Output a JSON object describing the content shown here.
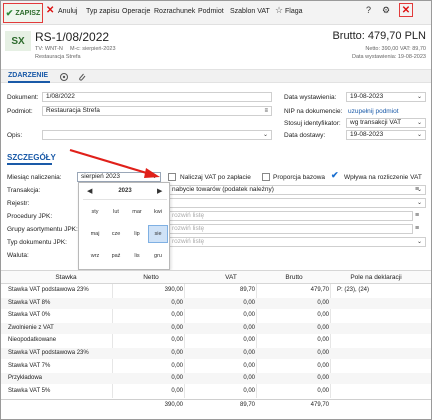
{
  "toolbar": {
    "save_label": "ZAPISZ",
    "cancel_label": "Anuluj",
    "typ_zapisu_label": "Typ zapisu",
    "operacje_label": "Operacje",
    "rozrachunek_label": "Rozrachunek",
    "podmiot_label": "Podmiot",
    "szablon_vat_label": "Szablon VAT",
    "flaga_label": "Flaga",
    "help_glyph": "?",
    "settings_glyph": "⚙",
    "close_glyph": "✕",
    "accent_color": "#e23b3b"
  },
  "header": {
    "badge": "SX",
    "document_title": "RS-1/08/2022",
    "tv_line": "TV: WNT-N",
    "period_line": "M-c: sierpień-2023",
    "counterparty_line": "Restauracja Strefa",
    "brutto_label": "Brutto: 479,70 PLN",
    "netto_vat_line": "Netto: 390,00 VAT: 89,70",
    "date_line": "Data wystawienia: 19-08-2023"
  },
  "tabs": {
    "active_label": "ZDARZENIE"
  },
  "form": {
    "dokument_label": "Dokument:",
    "dokument_value": "1/08/2022",
    "podmiot_label": "Podmiot:",
    "podmiot_value": "Restauracja Strefa",
    "opis_label": "Opis:",
    "data_wystawienia_label": "Data wystawienia:",
    "data_wystawienia_value": "19-08-2023",
    "nip_label": "NIP na dokumencie:",
    "nip_link": "uzupełnij podmiot",
    "stosuj_label": "Stosuj identyfikator:",
    "stosuj_value": "wg transakcji VAT",
    "data_dostawy_label": "Data dostawy:",
    "data_dostawy_value": "19-08-2023"
  },
  "details": {
    "section_title": "SZCZEGÓŁY",
    "miesiac_label": "Miesiąc naliczenia:",
    "miesiac_value": "sierpień 2023",
    "nalicz_vat_label": "Naliczaj VAT po zapłacie",
    "proporcja_label": "Proporcja bazowa",
    "wplywa_label": "Wpływa na rozliczenie VAT",
    "transakcja_label": "Transakcja:",
    "transakcja_value": "nabycie towarów (podatek należny)",
    "rejestr_label": "Rejestr:",
    "procedury_label": "Procedury JPK:",
    "procedury_placeholder": "rozwiń listę",
    "grupy_label": "Grupy asortymentu JPK:",
    "grupy_placeholder": "rozwiń listę",
    "typ_dok_label": "Typ dokumentu JPK:",
    "typ_dok_placeholder": "rozwiń listę",
    "waluta_label": "Waluta:"
  },
  "calendar": {
    "year": "2023",
    "prev_glyph": "◀",
    "next_glyph": "▶",
    "months": [
      "sty",
      "lut",
      "mar",
      "kwi",
      "maj",
      "cze",
      "lip",
      "sie",
      "wrz",
      "paź",
      "lis",
      "gru"
    ],
    "selected_month": "sie"
  },
  "table": {
    "headers": [
      "Stawka",
      "Netto",
      "VAT",
      "Brutto",
      "Pole na deklaracji"
    ],
    "rows": [
      {
        "stawka": "Stawka VAT podstawowa 23%",
        "netto": "390,00",
        "vat": "89,70",
        "brutto": "479,70",
        "pole": "P: (23), (24)"
      },
      {
        "stawka": "Stawka VAT 8%",
        "netto": "0,00",
        "vat": "0,00",
        "brutto": "0,00",
        "pole": ""
      },
      {
        "stawka": "Stawka VAT 0%",
        "netto": "0,00",
        "vat": "0,00",
        "brutto": "0,00",
        "pole": ""
      },
      {
        "stawka": "Zwolnienie z VAT",
        "netto": "0,00",
        "vat": "0,00",
        "brutto": "0,00",
        "pole": ""
      },
      {
        "stawka": "Nieopodatkowane",
        "netto": "0,00",
        "vat": "0,00",
        "brutto": "0,00",
        "pole": ""
      },
      {
        "stawka": " Stawka VAT podstawowa 23%",
        "netto": "0,00",
        "vat": "0,00",
        "brutto": "0,00",
        "pole": ""
      },
      {
        "stawka": "Stawka VAT 7%",
        "netto": "0,00",
        "vat": "0,00",
        "brutto": "0,00",
        "pole": ""
      },
      {
        "stawka": "Przykładowa",
        "netto": "0,00",
        "vat": "0,00",
        "brutto": "0,00",
        "pole": ""
      },
      {
        "stawka": "Stawka VAT 5%",
        "netto": "0,00",
        "vat": "0,00",
        "brutto": "0,00",
        "pole": ""
      }
    ],
    "totals": {
      "netto": "390,00",
      "vat": "89,70",
      "brutto": "479,70"
    }
  },
  "icons": {
    "save": "check-icon",
    "cancel": "x-icon",
    "flag": "star-icon",
    "dropdown": "chevron-down-icon",
    "menu": "hamburger-icon"
  }
}
